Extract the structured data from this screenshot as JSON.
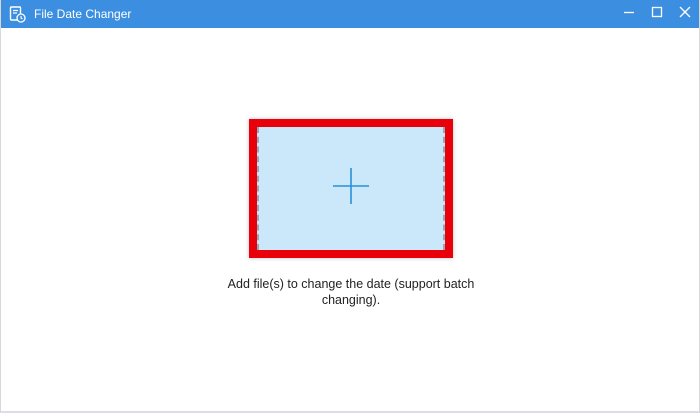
{
  "window": {
    "title": "File Date Changer",
    "accent_color": "#3c8fe0",
    "app_icon": "file-clock-icon",
    "controls": {
      "minimize_icon": "minimize-icon",
      "maximize_icon": "maximize-icon",
      "close_icon": "close-icon"
    }
  },
  "drop_zone": {
    "icon": "plus-icon",
    "highlight_color": "#e8000b",
    "fill_color": "#cbe8fb",
    "hint_text": "Add file(s) to change the date (support batch changing)."
  }
}
